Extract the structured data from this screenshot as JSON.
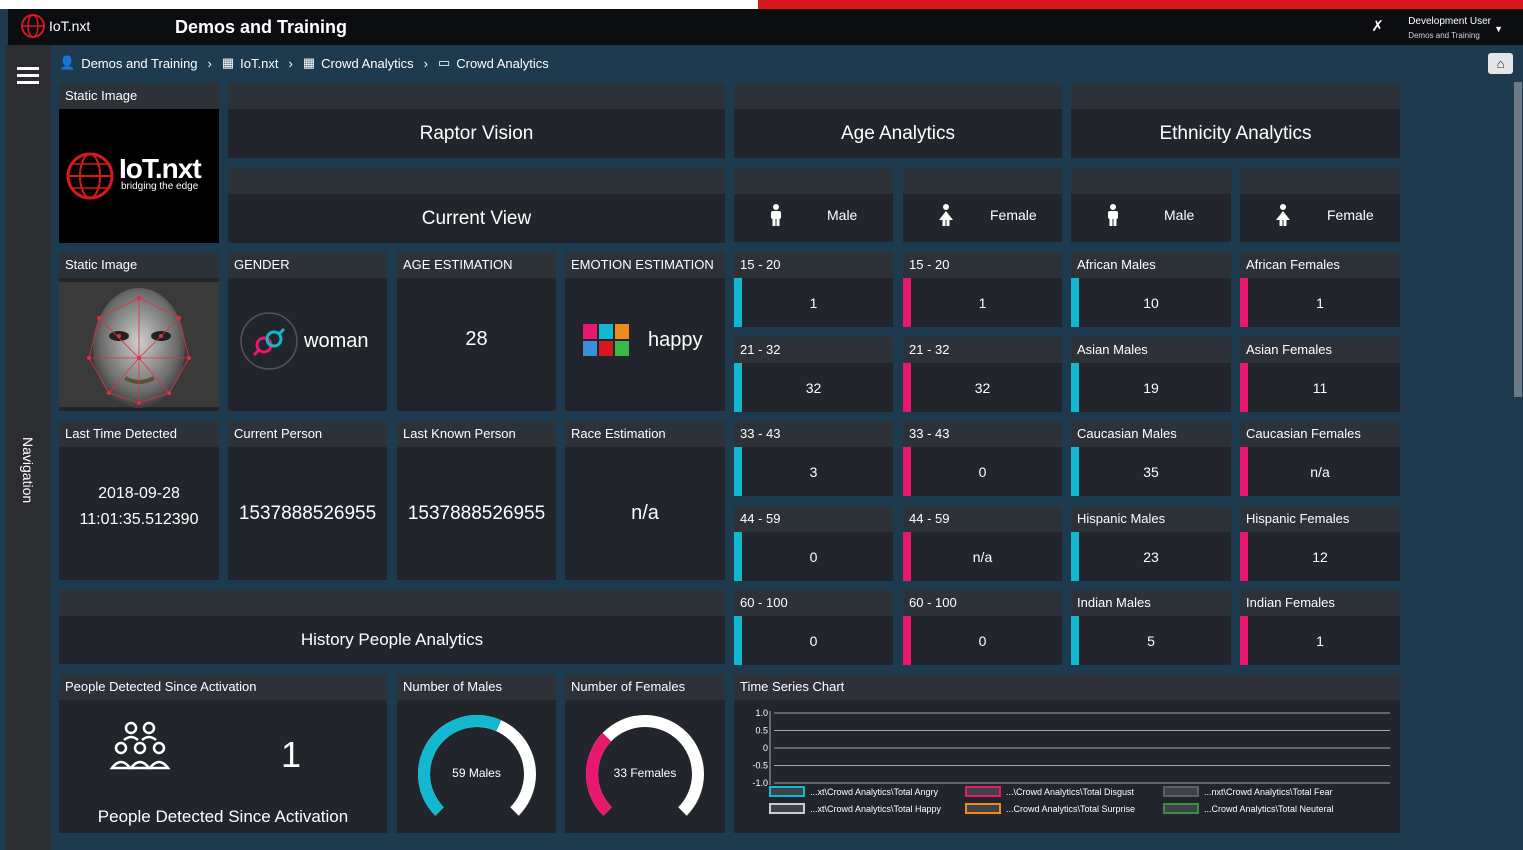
{
  "header": {
    "logo_text": "IoT.nxt",
    "title": "Demos and Training",
    "user_name": "Development User",
    "user_sub": "Demos and Training"
  },
  "breadcrumb": [
    {
      "label": "Demos and Training",
      "icon": "user-icon"
    },
    {
      "label": "IoT.nxt",
      "icon": "grid-icon"
    },
    {
      "label": "Crowd Analytics",
      "icon": "grid-icon"
    },
    {
      "label": "Crowd Analytics",
      "icon": "monitor-icon"
    }
  ],
  "sidebar": {
    "nav_label": "Navigation"
  },
  "static_image": {
    "title": "Static Image",
    "logo_main": "IoT.nxt",
    "logo_sub": "bridging the edge"
  },
  "face_image": {
    "title": "Static Image"
  },
  "banners": {
    "raptor": "Raptor Vision",
    "current_view": "Current View",
    "age": "Age Analytics",
    "ethnicity": "Ethnicity Analytics",
    "history": "History People Analytics"
  },
  "gender_headers": {
    "male": "Male",
    "female": "Female"
  },
  "gender": {
    "title": "GENDER",
    "value": "woman"
  },
  "age_estimation": {
    "title": "AGE ESTIMATION",
    "value": "28"
  },
  "emotion": {
    "title": "EMOTION ESTIMATION",
    "value": "happy"
  },
  "last_time": {
    "title": "Last Time Detected",
    "date": "2018-09-28",
    "time": "11:01:35.512390"
  },
  "current_person": {
    "title": "Current Person",
    "value": "1537888526955"
  },
  "last_known": {
    "title": "Last Known Person",
    "value": "1537888526955"
  },
  "race": {
    "title": "Race Estimation",
    "value": "n/a"
  },
  "age_male": [
    {
      "label": "15 - 20",
      "value": "1"
    },
    {
      "label": "21 - 32",
      "value": "32"
    },
    {
      "label": "33 - 43",
      "value": "3"
    },
    {
      "label": "44 - 59",
      "value": "0"
    },
    {
      "label": "60 - 100",
      "value": "0"
    }
  ],
  "age_female": [
    {
      "label": "15 - 20",
      "value": "1"
    },
    {
      "label": "21 - 32",
      "value": "32"
    },
    {
      "label": "33 - 43",
      "value": "0"
    },
    {
      "label": "44 - 59",
      "value": "n/a"
    },
    {
      "label": "60 - 100",
      "value": "0"
    }
  ],
  "eth_male": [
    {
      "label": "African Males",
      "value": "10"
    },
    {
      "label": "Asian Males",
      "value": "19"
    },
    {
      "label": "Caucasian Males",
      "value": "35"
    },
    {
      "label": "Hispanic Males",
      "value": "23"
    },
    {
      "label": "Indian Males",
      "value": "5"
    }
  ],
  "eth_female": [
    {
      "label": "African Females",
      "value": "1"
    },
    {
      "label": "Asian Females",
      "value": "11"
    },
    {
      "label": "Caucasian Females",
      "value": "n/a"
    },
    {
      "label": "Hispanic Females",
      "value": "12"
    },
    {
      "label": "Indian Females",
      "value": "1"
    }
  ],
  "people_detected": {
    "title": "People Detected Since Activation",
    "value": "1",
    "caption": "People Detected Since Activation"
  },
  "num_males": {
    "title": "Number of Males",
    "label": "59 Males",
    "fraction": 0.59
  },
  "num_females": {
    "title": "Number of Females",
    "label": "33 Females",
    "fraction": 0.33
  },
  "colors": {
    "male": "#12b7d0",
    "female": "#e8186f",
    "gauge_bg": "#ffffff"
  },
  "chart_data": {
    "type": "line",
    "title": "Time Series Chart",
    "ylim": [
      -1.0,
      1.0
    ],
    "y_ticks": [
      "1.0",
      "0.5",
      "0",
      "-0.5",
      "-1.0"
    ],
    "grid": true,
    "legend_position": "bottom",
    "series": [
      {
        "name": "...xt\\Crowd Analytics\\Total Angry",
        "color": "#12b7d0",
        "values": []
      },
      {
        "name": "...\\Crowd Analytics\\Total Disgust",
        "color": "#e8186f",
        "values": []
      },
      {
        "name": "...nxt\\Crowd Analytics\\Total Fear",
        "color": "#5a5f66",
        "values": []
      },
      {
        "name": "...xt\\Crowd Analytics\\Total Happy",
        "color": "#c9cdd2",
        "values": []
      },
      {
        "name": "...Crowd Analytics\\Total Surprise",
        "color": "#f08a1c",
        "values": []
      },
      {
        "name": "...Crowd Analytics\\Total Neuteral",
        "color": "#3c8f3c",
        "values": []
      }
    ]
  }
}
